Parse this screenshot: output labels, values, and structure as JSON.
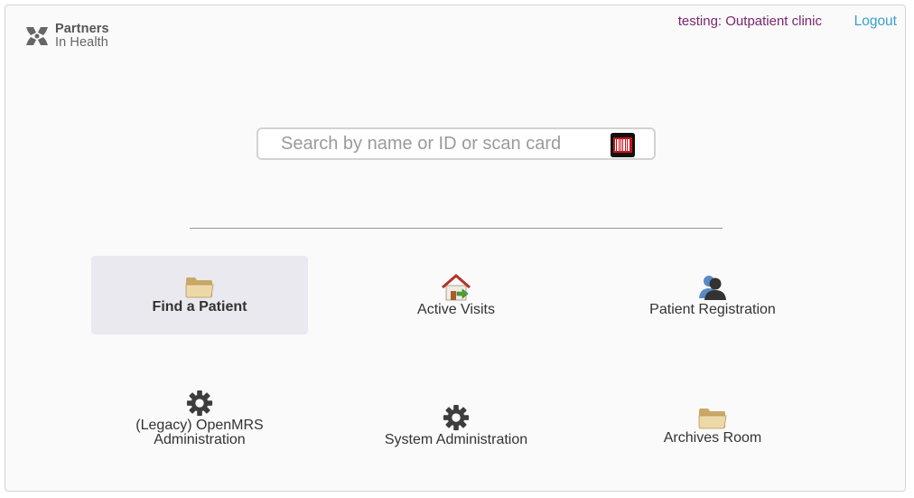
{
  "header": {
    "logo": {
      "line1": "Partners",
      "line2": "In Health"
    },
    "location": "testing: Outpatient clinic",
    "logout": "Logout"
  },
  "search": {
    "placeholder": "Search by name or ID or scan card",
    "value": "",
    "scan_icon": "barcode-icon"
  },
  "apps": [
    {
      "label": "Find a Patient",
      "icon": "folder-icon",
      "selected": true
    },
    {
      "label": "Active Visits",
      "icon": "house-icon",
      "selected": false
    },
    {
      "label": "Patient Registration",
      "icon": "user-icon",
      "selected": false
    },
    {
      "label": "(Legacy) OpenMRS\nAdministration",
      "icon": "gear-icon",
      "selected": false
    },
    {
      "label": "System Administration",
      "icon": "gear-icon",
      "selected": false
    },
    {
      "label": "Archives Room",
      "icon": "folder-icon",
      "selected": false
    }
  ],
  "colors": {
    "location": "#7b2570",
    "logout": "#38a0cc",
    "selected_tile": "#e9e9ef"
  }
}
